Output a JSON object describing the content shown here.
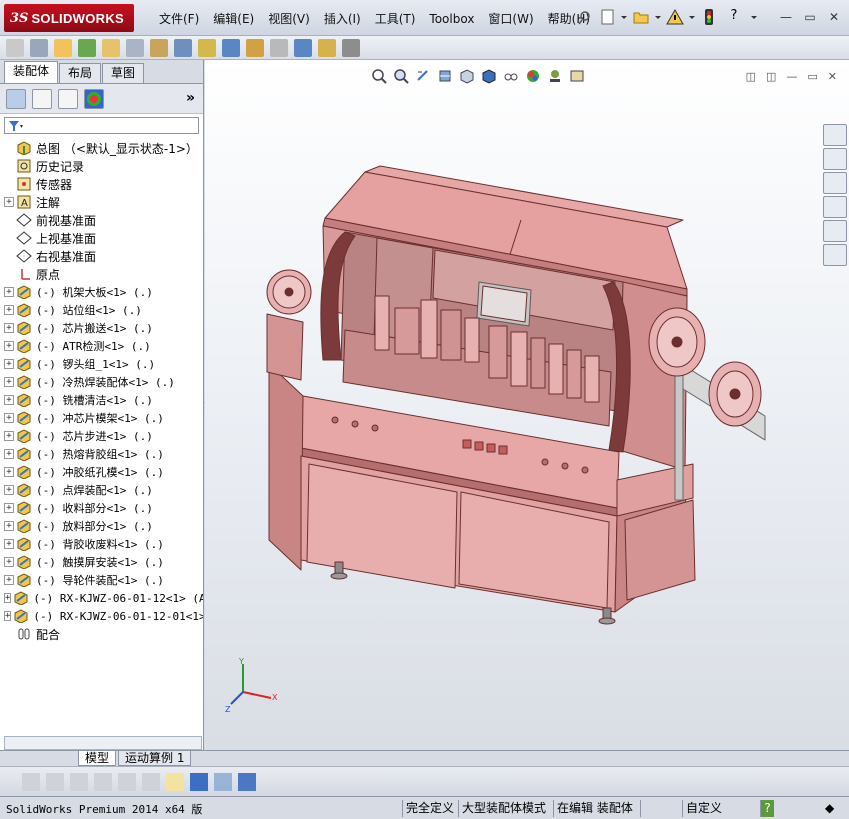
{
  "app": {
    "logo_ds": "3S",
    "logo_text": "SOLIDWORKS",
    "menu": [
      "文件(F)",
      "编辑(E)",
      "视图(V)",
      "插入(I)",
      "工具(T)",
      "Toolbox",
      "窗口(W)",
      "帮助(H)"
    ],
    "help_label": "?"
  },
  "left_panel": {
    "tabs": [
      "装配体",
      "布局",
      "草图"
    ],
    "expand_glyph": "»",
    "tree": [
      {
        "label": "总图 （<默认_显示状态-1>）",
        "icon": "assembly-icon",
        "expand": false,
        "mono": false
      },
      {
        "label": "历史记录",
        "icon": "history-icon",
        "expand": false,
        "mono": false
      },
      {
        "label": "传感器",
        "icon": "sensor-icon",
        "expand": false,
        "mono": false
      },
      {
        "label": "注解",
        "icon": "annotation-icon",
        "expand": true,
        "mono": false
      },
      {
        "label": "前视基准面",
        "icon": "plane-icon",
        "expand": false,
        "mono": false
      },
      {
        "label": "上视基准面",
        "icon": "plane-icon",
        "expand": false,
        "mono": false
      },
      {
        "label": "右视基准面",
        "icon": "plane-icon",
        "expand": false,
        "mono": false
      },
      {
        "label": "原点",
        "icon": "origin-icon",
        "expand": false,
        "mono": false
      },
      {
        "label": "(-) 机架大板<1> (.)",
        "icon": "subassembly-icon",
        "expand": true,
        "mono": true
      },
      {
        "label": "(-) 站位组<1> (.)",
        "icon": "subassembly-icon",
        "expand": true,
        "mono": true
      },
      {
        "label": "(-) 芯片搬送<1> (.)",
        "icon": "subassembly-icon",
        "expand": true,
        "mono": true
      },
      {
        "label": "(-) ATR检测<1> (.)",
        "icon": "subassembly-icon",
        "expand": true,
        "mono": true
      },
      {
        "label": "(-) 锣头组_1<1> (.)",
        "icon": "subassembly-icon",
        "expand": true,
        "mono": true
      },
      {
        "label": "(-) 冷热焊装配体<1> (.)",
        "icon": "subassembly-icon",
        "expand": true,
        "mono": true
      },
      {
        "label": "(-) 铣槽清洁<1> (.)",
        "icon": "subassembly-icon",
        "expand": true,
        "mono": true
      },
      {
        "label": "(-) 冲芯片模架<1> (.)",
        "icon": "subassembly-icon",
        "expand": true,
        "mono": true
      },
      {
        "label": "(-) 芯片步进<1> (.)",
        "icon": "subassembly-icon",
        "expand": true,
        "mono": true
      },
      {
        "label": "(-) 热熔背胶组<1> (.)",
        "icon": "subassembly-icon",
        "expand": true,
        "mono": true
      },
      {
        "label": "(-) 冲胶纸孔模<1> (.)",
        "icon": "subassembly-icon",
        "expand": true,
        "mono": true
      },
      {
        "label": "(-) 点焊装配<1> (.)",
        "icon": "subassembly-icon",
        "expand": true,
        "mono": true
      },
      {
        "label": "(-) 收料部分<1> (.)",
        "icon": "subassembly-icon",
        "expand": true,
        "mono": true
      },
      {
        "label": "(-) 放料部分<1> (.)",
        "icon": "subassembly-icon",
        "expand": true,
        "mono": true
      },
      {
        "label": "(-) 背胶收废料<1> (.)",
        "icon": "subassembly-icon",
        "expand": true,
        "mono": true
      },
      {
        "label": "(-) 触摸屏安装<1> (.)",
        "icon": "subassembly-icon",
        "expand": true,
        "mono": true
      },
      {
        "label": "(-) 导轮件装配<1> (.)",
        "icon": "subassembly-icon",
        "expand": true,
        "mono": true
      },
      {
        "label": "(-) RX-KJWZ-06-01-12<1> (A",
        "icon": "subassembly-icon",
        "expand": true,
        "mono": true
      },
      {
        "label": "(-) RX-KJWZ-06-01-12-01<1>",
        "icon": "subassembly-icon",
        "expand": true,
        "mono": true
      },
      {
        "label": "配合",
        "icon": "mates-icon",
        "expand": false,
        "mono": false
      }
    ]
  },
  "bottom_tabs": [
    "模型",
    "运动算例 1"
  ],
  "status": {
    "product": "SolidWorks Premium 2014 x64 版",
    "fully_defined": "完全定义",
    "large_assembly": "大型装配体模式",
    "editing": "在编辑 装配体",
    "custom": "自定义",
    "help": "?"
  },
  "colors": {
    "model_fill": "#e8a7a7",
    "model_dark": "#b56d6d",
    "accent_red": "#c8101f"
  }
}
